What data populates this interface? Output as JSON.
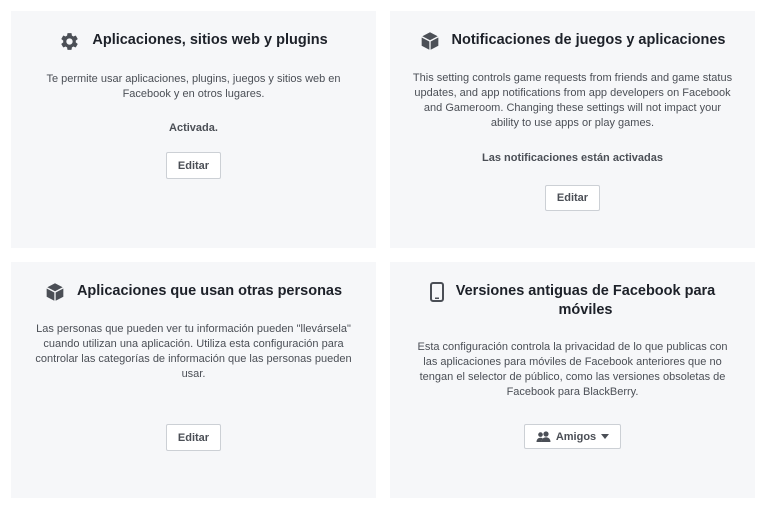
{
  "cards": [
    {
      "icon": "gear-icon",
      "title": "Aplicaciones, sitios web y plugins",
      "description": "Te permite usar aplicaciones, plugins, juegos y sitios web en Facebook y en otros lugares.",
      "status": "Activada.",
      "button_label": "Editar"
    },
    {
      "icon": "cube-icon",
      "title": "Notificaciones de juegos y aplicaciones",
      "description": "This setting controls game requests from friends and game status updates, and app notifications from app developers on Facebook and Gameroom. Changing these settings will not impact your ability to use apps or play games.",
      "status": "Las notificaciones están activadas",
      "button_label": "Editar"
    },
    {
      "icon": "cube-icon",
      "title": "Aplicaciones que usan otras personas",
      "description": "Las personas que pueden ver tu información pueden \"llevársela\" cuando utilizan una aplicación. Utiliza esta configuración para controlar las categorías de información que las personas pueden usar.",
      "button_label": "Editar"
    },
    {
      "icon": "mobile-phone-icon",
      "title": "Versiones antiguas de Facebook para móviles",
      "description": "Esta configuración controla la privacidad de lo que publicas con las aplicaciones para móviles de Facebook anteriores que no tengan el selector de público, como las versiones obsoletas de Facebook para BlackBerry.",
      "button_label": "Amigos",
      "button_icon": "friends-icon",
      "button_caret": "caret-down-icon"
    }
  ]
}
